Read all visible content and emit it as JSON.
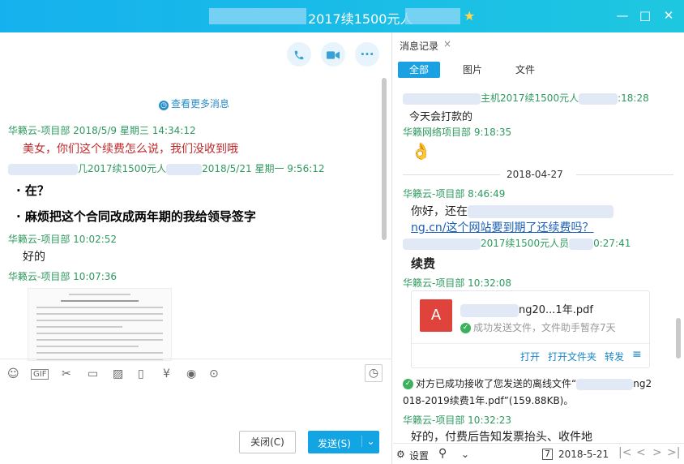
{
  "window": {
    "title": "2017续1500元人",
    "min": "—",
    "max": "□",
    "close": "✕"
  },
  "chat": {
    "more_messages": "查看更多消息",
    "messages": [
      {
        "sender": "华籁云-项目部",
        "time": "2018/5/9 星期三 14:34:12",
        "text": "美女，你们这个续费怎么说，我们没收到哦"
      },
      {
        "sender_partial": "几2017续1500元人",
        "time": "2018/5/21 星期一 9:56:12",
        "lines": [
          "在？",
          "麻烦把这个合同改成两年期的我给领导签字"
        ]
      },
      {
        "sender": "华籁云-项目部",
        "time": "10:02:52",
        "text": "好的"
      },
      {
        "sender": "华籁云-项目部",
        "time": "10:07:36"
      }
    ]
  },
  "toolbar": {
    "close_label": "关闭(C)",
    "send_label": "发送(S)",
    "send_arrow": "⌄"
  },
  "history": {
    "tab_label": "消息记录",
    "tab_close": "×",
    "filters": [
      "全部",
      "图片",
      "文件"
    ],
    "entries": [
      {
        "sender": "主机2017续1500元人",
        "time": ":18:28",
        "text": "今天会打款的"
      },
      {
        "sender": "华籁网络项目部",
        "time": "9:18:35",
        "emoji": "👌"
      },
      {
        "date": "2018-04-27"
      },
      {
        "sender": "华籁云-项目部",
        "time": "8:46:49",
        "text1": "你好，还在",
        "text2": "ng.cn/这个网站要到期了还续费吗？"
      },
      {
        "sender": "2017续1500元人员",
        "time": "0:27:41",
        "text": "续费"
      },
      {
        "sender": "华籁云-项目部",
        "time": "10:32:08"
      },
      {
        "sender": "华籁云-项目部",
        "time": "10:32:23",
        "text": "好的，付费后告知发票抬头、收件地"
      }
    ],
    "file": {
      "name": "ng20...1年.pdf",
      "status": "成功发送文件，文件助手暂存7天",
      "actions": [
        "打开",
        "打开文件夹",
        "转发"
      ]
    },
    "receipt": {
      "line1": "对方已成功接收了您发送的离线文件“",
      "line1_end": "ng2",
      "line2": "018-2019续费1年.pdf”(159.88KB)。"
    },
    "bottom": {
      "settings": "设置",
      "date": "2018-5-21"
    }
  }
}
